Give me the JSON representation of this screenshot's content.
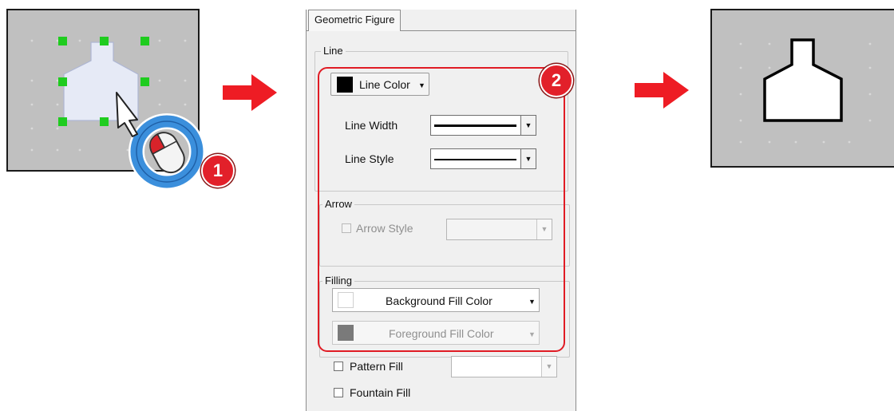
{
  "steps": {
    "step1": "1",
    "step2": "2"
  },
  "panel": {
    "tab_label": "Geometric Figure",
    "line_group": {
      "title": "Line",
      "color_button_label": "Line Color",
      "line_color": "#000000",
      "width_label": "Line Width",
      "style_label": "Line Style"
    },
    "arrow_group": {
      "title": "Arrow",
      "arrow_style_label": "Arrow Style",
      "arrow_style_checked": false,
      "arrow_style_enabled": false
    },
    "filling_group": {
      "title": "Filling",
      "background_fill_label": "Background Fill Color",
      "background_fill_color": "#ffffff",
      "foreground_fill_label": "Foreground Fill Color",
      "foreground_fill_color": "#7a7a7a"
    },
    "pattern_fill_label": "Pattern Fill",
    "pattern_fill_checked": false,
    "fountain_fill_label": "Fountain Fill",
    "fountain_fill_checked": false
  },
  "colors": {
    "canvas_bg": "#c0c0c0",
    "handle": "#1fcc1f",
    "shape_fill_selected": "#e6eaf6",
    "highlight": "#e01b24",
    "arrow": "#ee1c24",
    "cursor_ring": "#3b8fdc"
  },
  "icons": [
    "mouse-cursor-icon",
    "mouse-icon",
    "dropdown-caret-icon",
    "right-arrow-icon"
  ]
}
